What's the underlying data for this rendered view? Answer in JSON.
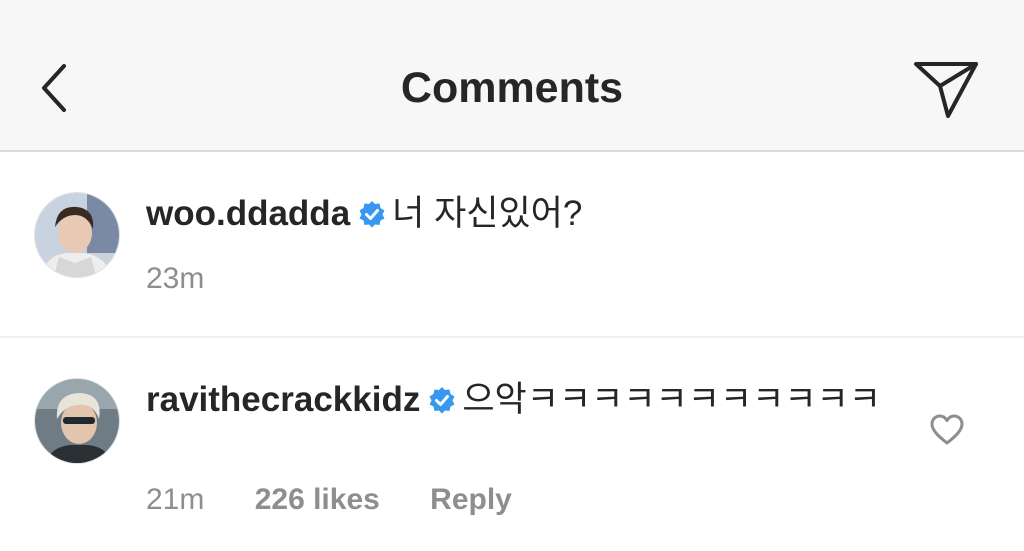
{
  "header": {
    "title": "Comments",
    "back_icon": "chevron-left-icon",
    "send_icon": "paper-plane-icon"
  },
  "comments": [
    {
      "username": "woo.ddadda",
      "verified": true,
      "text": "너 자신있어?",
      "time": "23m"
    },
    {
      "username": "ravithecrackkidz",
      "verified": true,
      "text": "으악ㅋㅋㅋㅋㅋㅋㅋㅋㅋㅋㅋ",
      "time": "21m",
      "likes": "226 likes",
      "reply": "Reply",
      "like_icon": "heart-outline-icon"
    }
  ],
  "colors": {
    "header_bg": "#f7f7f7",
    "verified_blue": "#3897f0",
    "meta_gray": "#8e8e8e",
    "text": "#262626"
  }
}
